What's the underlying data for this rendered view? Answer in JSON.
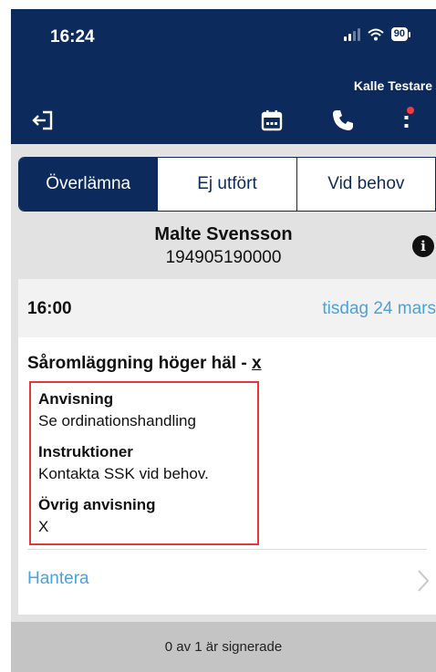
{
  "status_bar": {
    "time": "16:24",
    "battery": "90",
    "icons": [
      "signal-icon",
      "wifi-icon",
      "battery-icon"
    ]
  },
  "header": {
    "user_name": "Kalle Testare"
  },
  "toolbar": {
    "icons": [
      "logout-icon",
      "calendar-icon",
      "phone-icon",
      "more-icon"
    ],
    "notification_color": "#f03c3c"
  },
  "tabs": [
    {
      "label": "Överlämna",
      "active": true
    },
    {
      "label": "Ej utfört",
      "active": false
    },
    {
      "label": "Vid behov",
      "active": false
    }
  ],
  "patient": {
    "name": "Malte Svensson",
    "id": "194905190000"
  },
  "visit": {
    "time": "16:00",
    "date": "tisdag 24 mars"
  },
  "task": {
    "title": "Såromläggning höger häl - ",
    "title_suffix": "x",
    "fields": [
      {
        "label": "Anvisning",
        "value": "Se ordinationshandling"
      },
      {
        "label": "Instruktioner",
        "value": "Kontakta SSK vid behov."
      },
      {
        "label": "Övrig anvisning",
        "value": "X"
      }
    ],
    "action_label": "Hantera"
  },
  "footer": {
    "status": "0 av 1 är signerade"
  },
  "colors": {
    "brand_navy": "#0d2a5c",
    "accent_blue": "#4aa3df",
    "highlight_red": "#e0383e"
  }
}
